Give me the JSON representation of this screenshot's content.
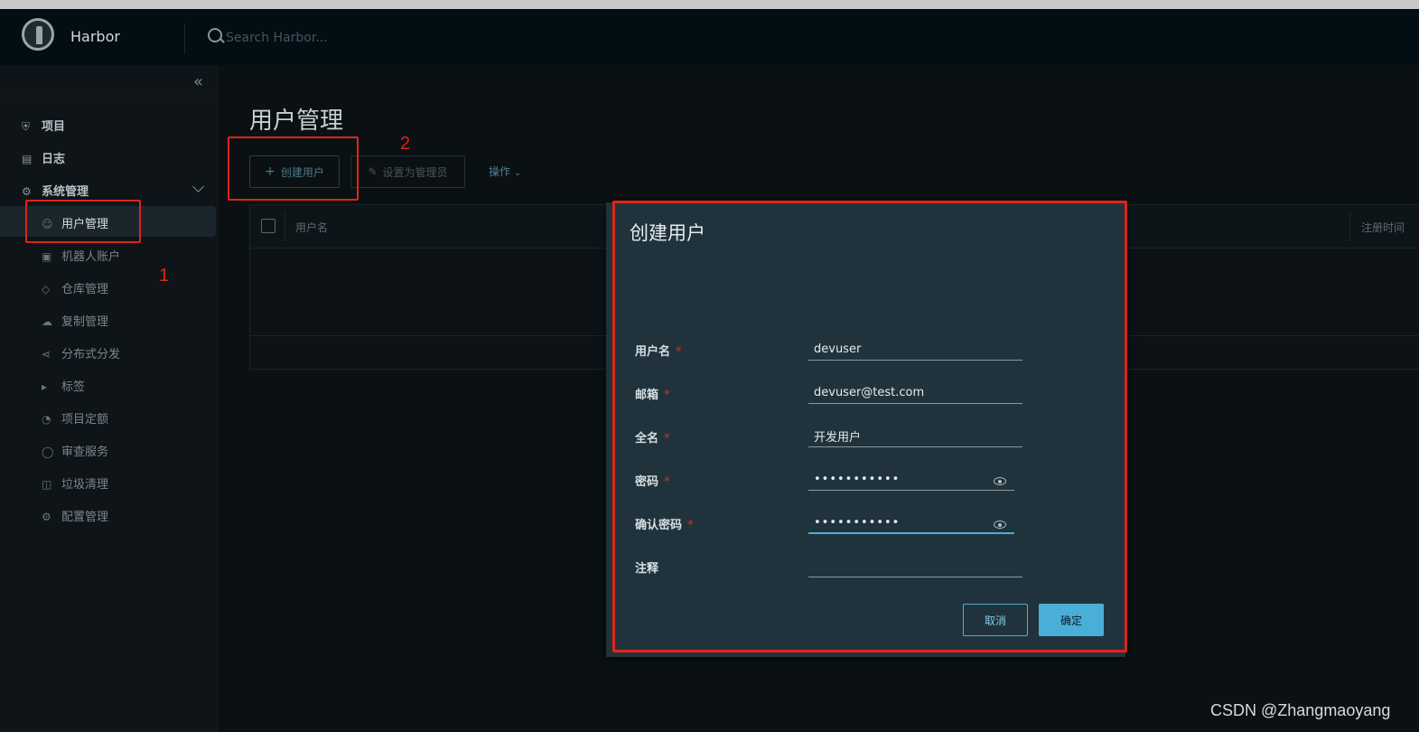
{
  "header": {
    "brand": "Harbor",
    "search_placeholder": "Search Harbor..."
  },
  "sidebar": {
    "collapse_icon": "double-chevron-left-icon",
    "items": [
      {
        "label": "项目",
        "icon": "projects-icon"
      },
      {
        "label": "日志",
        "icon": "logs-icon"
      },
      {
        "label": "系统管理",
        "icon": "admin-icon"
      }
    ],
    "sub_items": [
      {
        "label": "用户管理",
        "icon": "users-icon",
        "active": true
      },
      {
        "label": "机器人账户",
        "icon": "robot-icon"
      },
      {
        "label": "仓库管理",
        "icon": "cube-icon"
      },
      {
        "label": "复制管理",
        "icon": "cloud-icon"
      },
      {
        "label": "分布式分发",
        "icon": "share-icon"
      },
      {
        "label": "标签",
        "icon": "tag-icon"
      },
      {
        "label": "项目定额",
        "icon": "gauge-icon"
      },
      {
        "label": "审查服务",
        "icon": "shield-icon"
      },
      {
        "label": "垃圾清理",
        "icon": "trash-icon"
      },
      {
        "label": "配置管理",
        "icon": "gear-icon"
      }
    ]
  },
  "main": {
    "title": "用户管理",
    "toolbar": {
      "create_label": "创建用户",
      "set_admin_label": "设置为管理员",
      "actions_label": "操作"
    },
    "table": {
      "columns": [
        "用户名",
        "注册时间"
      ]
    }
  },
  "modal": {
    "title": "创建用户",
    "fields": [
      {
        "label": "用户名",
        "required": "*",
        "value": "devuser"
      },
      {
        "label": "邮箱",
        "required": "*",
        "value": "devuser@test.com"
      },
      {
        "label": "全名",
        "required": "*",
        "value": "开发用户"
      },
      {
        "label": "密码",
        "required": "*",
        "value": "•••••••••••"
      },
      {
        "label": "确认密码",
        "required": "*",
        "value": "•••••••••••"
      },
      {
        "label": "注释",
        "required": "",
        "value": ""
      }
    ],
    "cancel_label": "取消",
    "ok_label": "确定"
  },
  "annotations": {
    "num1": "1",
    "num2": "2",
    "color": "#e0241b"
  },
  "watermark": "CSDN @Zhangmaoyang",
  "colors": {
    "accent": "#49afd9",
    "header_bg": "#020d14",
    "modal_bg": "#20333c"
  }
}
